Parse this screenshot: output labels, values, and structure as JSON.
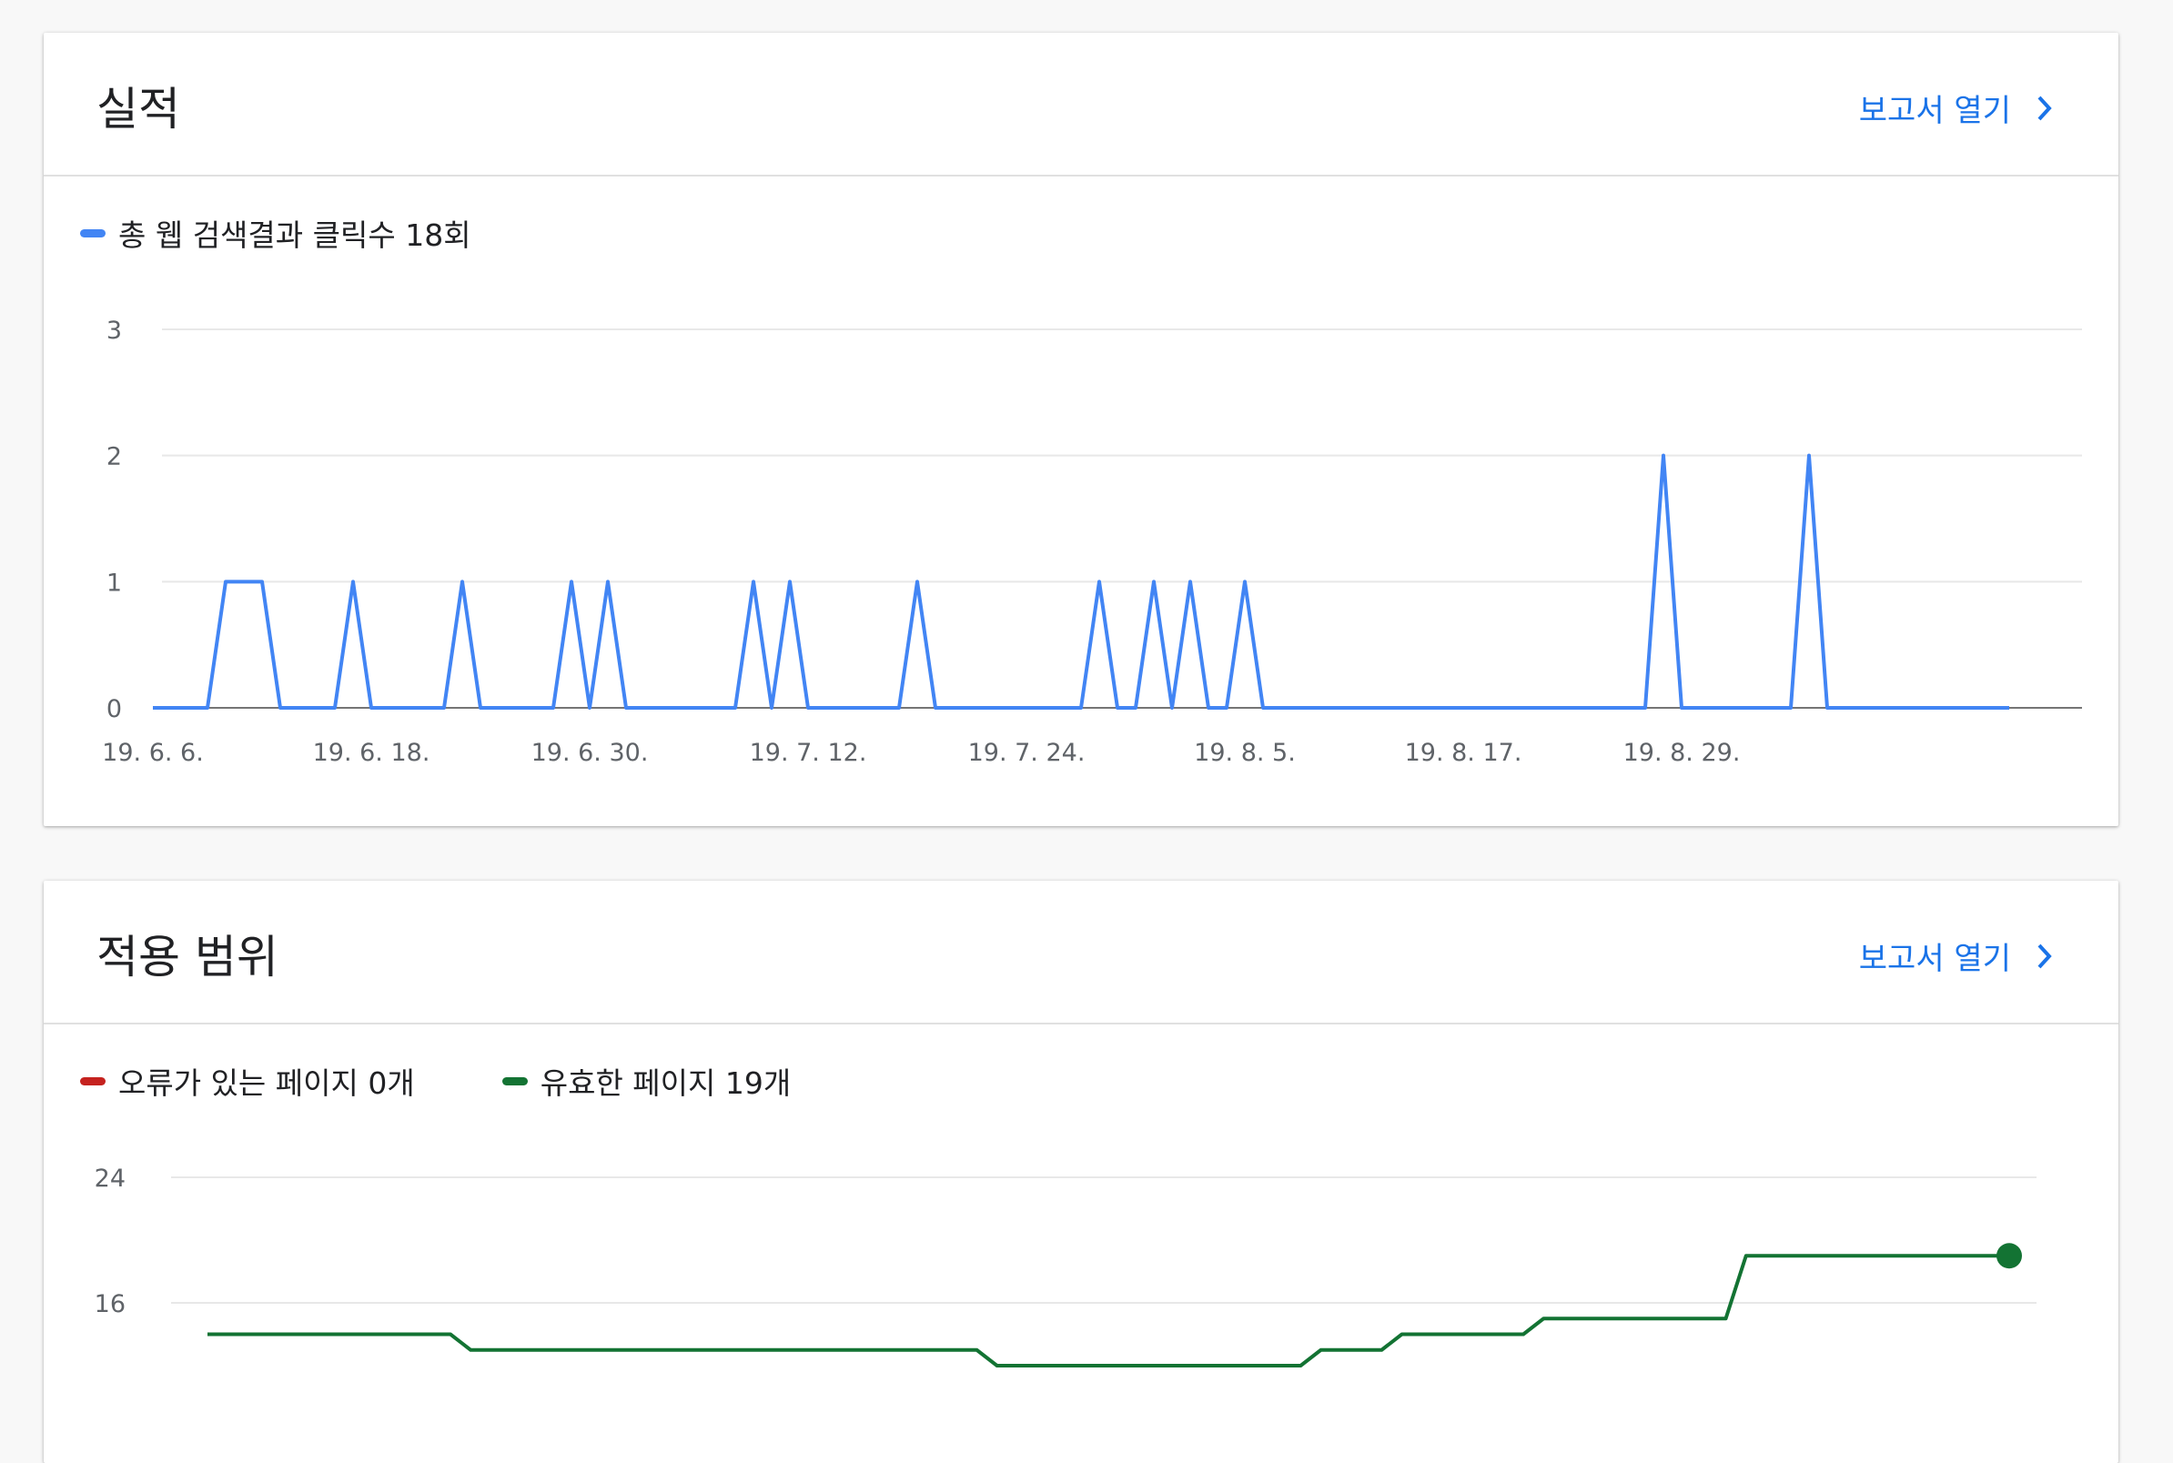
{
  "cards": {
    "performance": {
      "title": "실적",
      "open_report": "보고서 열기",
      "legend": [
        {
          "label": "총 웹 검색결과 클릭수 18회",
          "color": "#4285f4"
        }
      ]
    },
    "coverage": {
      "title": "적용 범위",
      "open_report": "보고서 열기",
      "legend": [
        {
          "label": "오류가 있는 페이지 0개",
          "color": "#c5221f"
        },
        {
          "label": "유효한 페이지 19개",
          "color": "#137333"
        }
      ]
    }
  },
  "chart_data": [
    {
      "type": "line",
      "title": "",
      "series": [
        {
          "name": "총 웹 검색결과 클릭수 18회",
          "color": "#4285f4",
          "values": [
            0,
            0,
            0,
            0,
            1,
            1,
            1,
            0,
            0,
            0,
            0,
            1,
            0,
            0,
            0,
            0,
            0,
            1,
            0,
            0,
            0,
            0,
            0,
            1,
            0,
            1,
            0,
            0,
            0,
            0,
            0,
            0,
            0,
            1,
            0,
            1,
            0,
            0,
            0,
            0,
            0,
            0,
            1,
            0,
            0,
            0,
            0,
            0,
            0,
            0,
            0,
            0,
            1,
            0,
            0,
            1,
            0,
            1,
            0,
            0,
            1,
            0,
            0,
            0,
            0,
            0,
            0,
            0,
            0,
            0,
            0,
            0,
            0,
            0,
            0,
            0,
            0,
            0,
            0,
            0,
            0,
            0,
            0,
            0,
            0,
            0,
            0,
            0,
            0,
            0,
            0,
            0,
            0,
            0,
            0,
            0,
            0,
            0,
            0,
            0,
            0,
            0,
            0
          ]
        }
      ],
      "x_tick_labels": [
        "19. 6. 6.",
        "19. 6. 18.",
        "19. 6. 30.",
        "19. 7. 12.",
        "19. 7. 24.",
        "19. 8. 5.",
        "19. 8. 17.",
        "19. 8. 29."
      ],
      "x_tick_index": [
        0,
        12,
        24,
        36,
        48,
        60,
        72,
        84
      ],
      "y_ticks": [
        0,
        1,
        2,
        3
      ],
      "ylim": [
        0,
        3
      ],
      "spikes_extra": [
        {
          "index": 83,
          "value": 2
        },
        {
          "index": 91,
          "value": 2
        }
      ],
      "grid": true
    },
    {
      "type": "line",
      "title": "",
      "series": [
        {
          "name": "오류가 있는 페이지 0개",
          "color": "#c5221f",
          "values": []
        },
        {
          "name": "유효한 페이지 19개",
          "color": "#137333",
          "values": [
            14,
            14,
            14,
            14,
            14,
            14,
            14,
            14,
            14,
            14,
            14,
            14,
            14,
            13,
            13,
            13,
            13,
            13,
            13,
            13,
            13,
            13,
            13,
            13,
            13,
            13,
            13,
            13,
            13,
            13,
            13,
            13,
            13,
            13,
            13,
            13,
            13,
            13,
            13,
            12,
            12,
            12,
            12,
            12,
            12,
            12,
            12,
            12,
            12,
            12,
            12,
            12,
            12,
            12,
            12,
            13,
            13,
            13,
            13,
            14,
            14,
            14,
            14,
            14,
            14,
            14,
            15,
            15,
            15,
            15,
            15,
            15,
            15,
            15,
            15,
            15,
            19,
            19,
            19,
            19,
            19,
            19,
            19,
            19,
            19,
            19,
            19,
            19,
            19,
            19
          ]
        }
      ],
      "y_ticks": [
        16,
        24
      ],
      "ylim": [
        8,
        24
      ],
      "grid": true
    }
  ]
}
